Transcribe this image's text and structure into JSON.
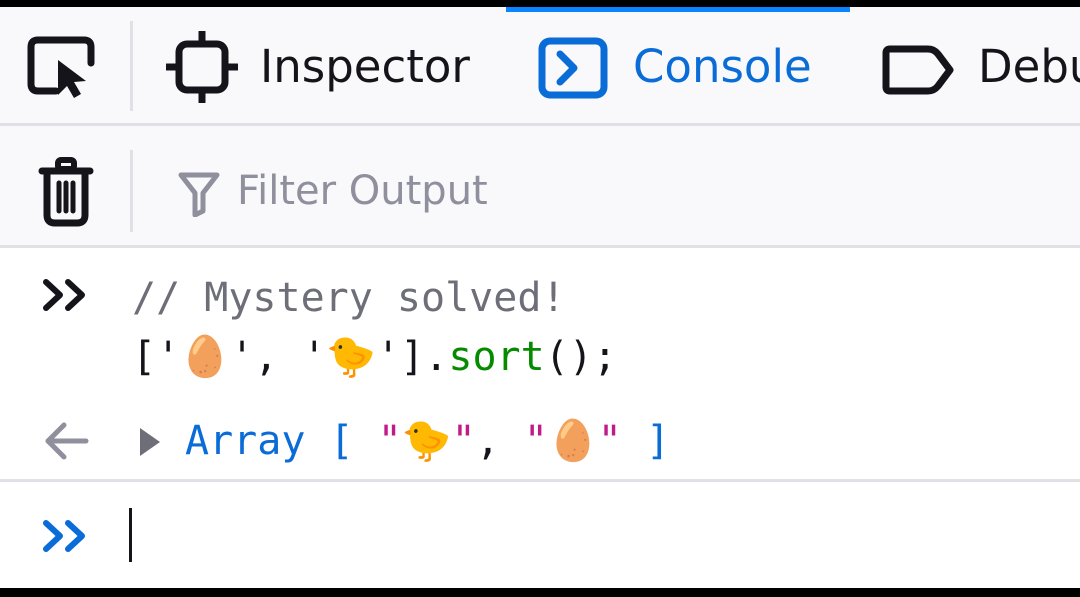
{
  "toolbar": {
    "tabs": [
      {
        "label": "Inspector",
        "active": false
      },
      {
        "label": "Console",
        "active": true
      },
      {
        "label": "Debu",
        "active": false
      }
    ],
    "accent_color": "#0a84ff"
  },
  "filter": {
    "placeholder": "Filter Output"
  },
  "console": {
    "input": {
      "comment": "// Mystery solved!",
      "code_open": "['",
      "item1": "🥚",
      "mid": "', '",
      "item2": "🐤",
      "code_close_bracket": "'].",
      "method": "sort",
      "tail": "();"
    },
    "result": {
      "label": "Array",
      "open": "[",
      "q1": "\"",
      "val1": "🐤",
      "q2": "\"",
      "sep": ",",
      "q3": "\"",
      "val2": "🥚",
      "q4": "\"",
      "close": "]"
    }
  }
}
